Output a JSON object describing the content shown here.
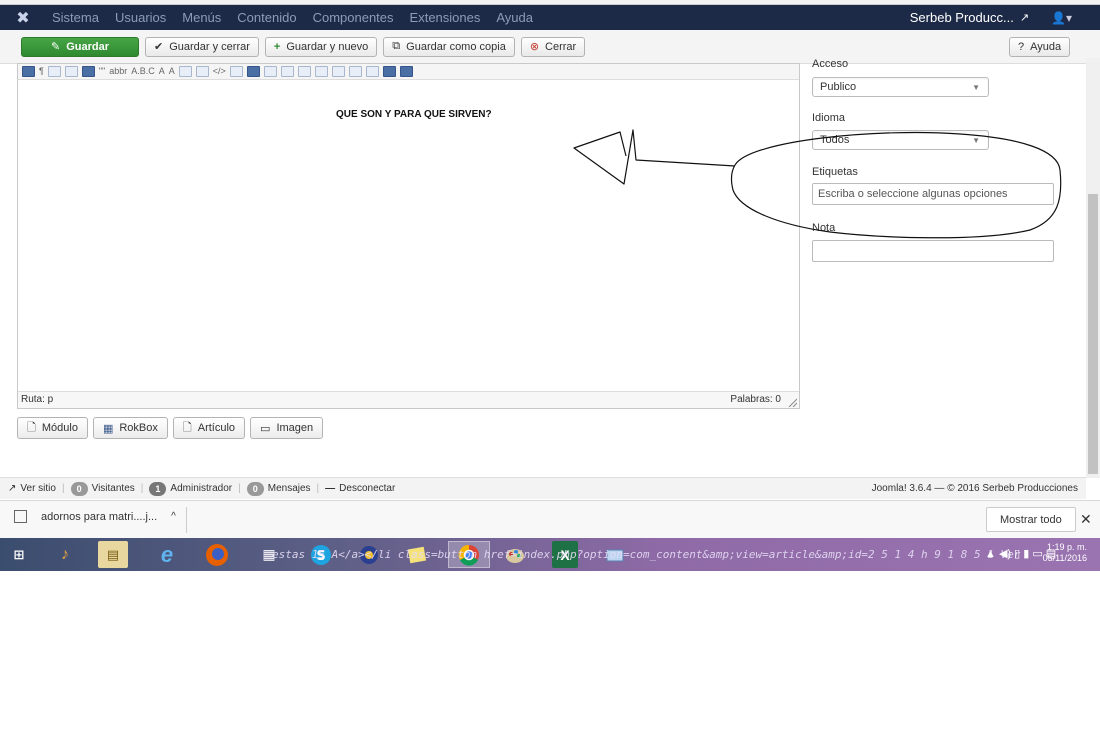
{
  "navbar": {
    "menu": [
      "Sistema",
      "Usuarios",
      "Menús",
      "Contenido",
      "Componentes",
      "Extensiones",
      "Ayuda"
    ],
    "site_name": "Serbeb Producc..."
  },
  "toolbar": {
    "save": "Guardar",
    "save_close": "Guardar y cerrar",
    "save_new": "Guardar y nuevo",
    "save_copy": "Guardar como copia",
    "close": "Cerrar",
    "help": "Ayuda"
  },
  "editor": {
    "heading": "QUE SON Y PARA QUE SIRVEN?",
    "path": "Ruta: p",
    "words": "Palabras: 0"
  },
  "insert_buttons": {
    "module": "Módulo",
    "rokbox": "RokBox",
    "article": "Artículo",
    "image": "Imagen"
  },
  "sidebar": {
    "access_label": "Acceso",
    "access_value": "Publico",
    "language_label": "Idioma",
    "language_value": "Todos",
    "tags_label": "Etiquetas",
    "tags_placeholder": "Escriba o seleccione algunas opciones",
    "note_label": "Nota",
    "note_value": ""
  },
  "statusbar": {
    "view_site": "Ver sitio",
    "visitors_count": "0",
    "visitors": "Visitantes",
    "admins_count": "1",
    "admins": "Administrador",
    "messages_count": "0",
    "messages": "Mensajes",
    "logout": "Desconectar",
    "version": "Joomla! 3.6.4 — © 2016 Serbeb Producciones"
  },
  "download_bar": {
    "filename": "adornos para matri....j...",
    "show_all": "Mostrar todo"
  },
  "taskbar": {
    "time": "1:19 p. m.",
    "date": "05/11/2016",
    "overlay_text": "estas 15 A</a></li class=button href=index.php?option=com_content&amp;view=article&amp;id=2 5 1 4 h 9 1 8 5 1 Ver"
  },
  "colors": {
    "navbar": "#1c2a47",
    "save_button": "#46a546",
    "taskbar_start": "#3b4d6e",
    "taskbar_end": "#9a74b0"
  }
}
